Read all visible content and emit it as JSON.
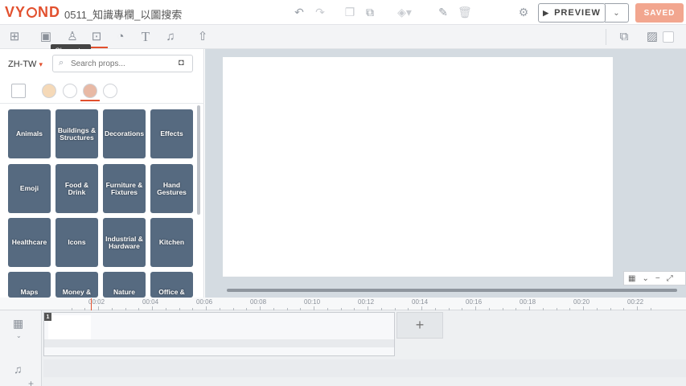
{
  "app": {
    "logo": "VYOND",
    "project_title": "0511_知識專欄_以圖搜索"
  },
  "topbar": {
    "icons": [
      "undo-icon",
      "redo-icon",
      "copy-icon",
      "paste-icon",
      "layers-icon",
      "brush-icon",
      "trash-icon",
      "settings-icon"
    ],
    "preview_label": "PREVIEW",
    "saved_label": "SAVED"
  },
  "toolbar2": {
    "icons": [
      "scene-icon",
      "template-icon",
      "character-icon",
      "props-icon",
      "charts-icon",
      "text-icon",
      "audio-icon",
      "upload-icon",
      "layout-icon",
      "image-icon"
    ],
    "tooltip": "Character"
  },
  "left_panel": {
    "language": "ZH-TW",
    "search_placeholder": "Search props...",
    "categories": [
      "Animals",
      "Buildings & Structures",
      "Decorations",
      "Effects",
      "Emoji",
      "Food & Drink",
      "Furniture & Fixtures",
      "Hand Gestures",
      "Healthcare",
      "Icons",
      "Industrial & Hardware",
      "Kitchen",
      "Maps",
      "Money &",
      "Nature",
      "Office &"
    ]
  },
  "timeline": {
    "ticks": [
      "00:02",
      "00:04",
      "00:06",
      "00:08",
      "00:10",
      "00:12",
      "00:14",
      "00:16",
      "00:18",
      "00:20",
      "00:22"
    ],
    "scene_number": "1",
    "add_scene": "+"
  },
  "colors": {
    "brand": "#e2502e",
    "tile": "#566a80",
    "stage_bg": "#d4dbe1"
  }
}
